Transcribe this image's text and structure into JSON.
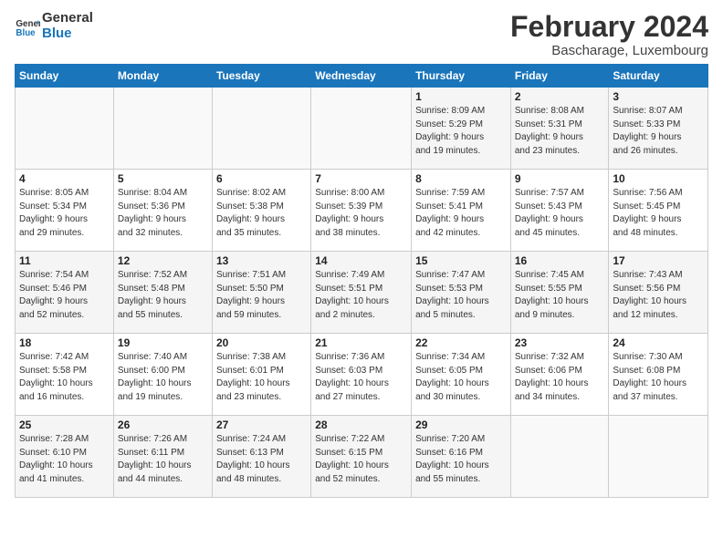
{
  "header": {
    "logo_line1": "General",
    "logo_line2": "Blue",
    "month": "February 2024",
    "location": "Bascharage, Luxembourg"
  },
  "days_of_week": [
    "Sunday",
    "Monday",
    "Tuesday",
    "Wednesday",
    "Thursday",
    "Friday",
    "Saturday"
  ],
  "weeks": [
    [
      {
        "day": "",
        "info": ""
      },
      {
        "day": "",
        "info": ""
      },
      {
        "day": "",
        "info": ""
      },
      {
        "day": "",
        "info": ""
      },
      {
        "day": "1",
        "info": "Sunrise: 8:09 AM\nSunset: 5:29 PM\nDaylight: 9 hours\nand 19 minutes."
      },
      {
        "day": "2",
        "info": "Sunrise: 8:08 AM\nSunset: 5:31 PM\nDaylight: 9 hours\nand 23 minutes."
      },
      {
        "day": "3",
        "info": "Sunrise: 8:07 AM\nSunset: 5:33 PM\nDaylight: 9 hours\nand 26 minutes."
      }
    ],
    [
      {
        "day": "4",
        "info": "Sunrise: 8:05 AM\nSunset: 5:34 PM\nDaylight: 9 hours\nand 29 minutes."
      },
      {
        "day": "5",
        "info": "Sunrise: 8:04 AM\nSunset: 5:36 PM\nDaylight: 9 hours\nand 32 minutes."
      },
      {
        "day": "6",
        "info": "Sunrise: 8:02 AM\nSunset: 5:38 PM\nDaylight: 9 hours\nand 35 minutes."
      },
      {
        "day": "7",
        "info": "Sunrise: 8:00 AM\nSunset: 5:39 PM\nDaylight: 9 hours\nand 38 minutes."
      },
      {
        "day": "8",
        "info": "Sunrise: 7:59 AM\nSunset: 5:41 PM\nDaylight: 9 hours\nand 42 minutes."
      },
      {
        "day": "9",
        "info": "Sunrise: 7:57 AM\nSunset: 5:43 PM\nDaylight: 9 hours\nand 45 minutes."
      },
      {
        "day": "10",
        "info": "Sunrise: 7:56 AM\nSunset: 5:45 PM\nDaylight: 9 hours\nand 48 minutes."
      }
    ],
    [
      {
        "day": "11",
        "info": "Sunrise: 7:54 AM\nSunset: 5:46 PM\nDaylight: 9 hours\nand 52 minutes."
      },
      {
        "day": "12",
        "info": "Sunrise: 7:52 AM\nSunset: 5:48 PM\nDaylight: 9 hours\nand 55 minutes."
      },
      {
        "day": "13",
        "info": "Sunrise: 7:51 AM\nSunset: 5:50 PM\nDaylight: 9 hours\nand 59 minutes."
      },
      {
        "day": "14",
        "info": "Sunrise: 7:49 AM\nSunset: 5:51 PM\nDaylight: 10 hours\nand 2 minutes."
      },
      {
        "day": "15",
        "info": "Sunrise: 7:47 AM\nSunset: 5:53 PM\nDaylight: 10 hours\nand 5 minutes."
      },
      {
        "day": "16",
        "info": "Sunrise: 7:45 AM\nSunset: 5:55 PM\nDaylight: 10 hours\nand 9 minutes."
      },
      {
        "day": "17",
        "info": "Sunrise: 7:43 AM\nSunset: 5:56 PM\nDaylight: 10 hours\nand 12 minutes."
      }
    ],
    [
      {
        "day": "18",
        "info": "Sunrise: 7:42 AM\nSunset: 5:58 PM\nDaylight: 10 hours\nand 16 minutes."
      },
      {
        "day": "19",
        "info": "Sunrise: 7:40 AM\nSunset: 6:00 PM\nDaylight: 10 hours\nand 19 minutes."
      },
      {
        "day": "20",
        "info": "Sunrise: 7:38 AM\nSunset: 6:01 PM\nDaylight: 10 hours\nand 23 minutes."
      },
      {
        "day": "21",
        "info": "Sunrise: 7:36 AM\nSunset: 6:03 PM\nDaylight: 10 hours\nand 27 minutes."
      },
      {
        "day": "22",
        "info": "Sunrise: 7:34 AM\nSunset: 6:05 PM\nDaylight: 10 hours\nand 30 minutes."
      },
      {
        "day": "23",
        "info": "Sunrise: 7:32 AM\nSunset: 6:06 PM\nDaylight: 10 hours\nand 34 minutes."
      },
      {
        "day": "24",
        "info": "Sunrise: 7:30 AM\nSunset: 6:08 PM\nDaylight: 10 hours\nand 37 minutes."
      }
    ],
    [
      {
        "day": "25",
        "info": "Sunrise: 7:28 AM\nSunset: 6:10 PM\nDaylight: 10 hours\nand 41 minutes."
      },
      {
        "day": "26",
        "info": "Sunrise: 7:26 AM\nSunset: 6:11 PM\nDaylight: 10 hours\nand 44 minutes."
      },
      {
        "day": "27",
        "info": "Sunrise: 7:24 AM\nSunset: 6:13 PM\nDaylight: 10 hours\nand 48 minutes."
      },
      {
        "day": "28",
        "info": "Sunrise: 7:22 AM\nSunset: 6:15 PM\nDaylight: 10 hours\nand 52 minutes."
      },
      {
        "day": "29",
        "info": "Sunrise: 7:20 AM\nSunset: 6:16 PM\nDaylight: 10 hours\nand 55 minutes."
      },
      {
        "day": "",
        "info": ""
      },
      {
        "day": "",
        "info": ""
      }
    ]
  ]
}
